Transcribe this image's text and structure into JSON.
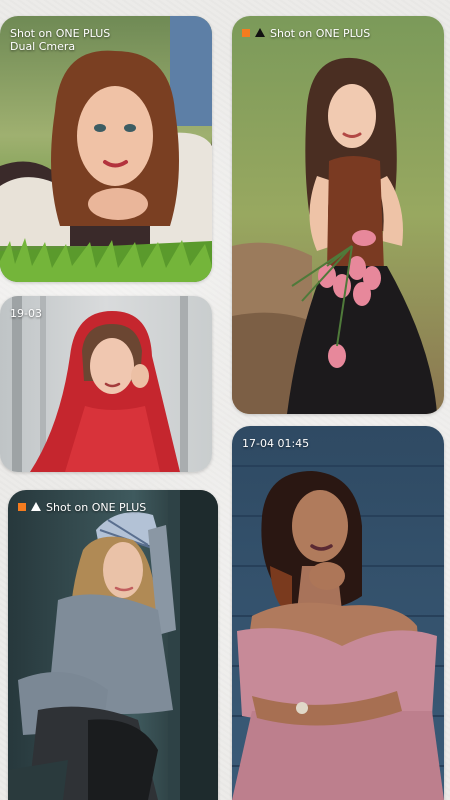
{
  "gallery": {
    "items": [
      {
        "caption_line1": "Shot on ONE PLUS",
        "caption_line2": "Dual Cmera"
      },
      {
        "caption_line1": "Shot on ONE PLUS"
      },
      {
        "caption_line1": "19-03"
      },
      {
        "caption_line1": "17-04 01:45"
      },
      {
        "caption_line1": "Shot on ONE PLUS"
      }
    ]
  },
  "colors": {
    "background": "#ecebe9",
    "watermark_square": "#f57c1f",
    "watermark_triangle_dark": "#111111",
    "caption_text": "#ffffff"
  },
  "icons": [
    "oneplus-square-icon",
    "oneplus-triangle-icon"
  ]
}
